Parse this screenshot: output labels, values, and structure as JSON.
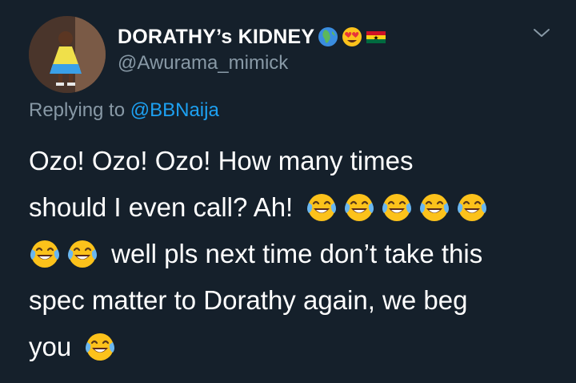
{
  "tweet": {
    "author": {
      "display_name": "DORATHY’s KIDNEY",
      "name_emojis": [
        "globe-africa-icon",
        "heart-eyes-icon",
        "ghana-flag-icon"
      ],
      "handle": "@Awurama_mimick",
      "avatar": "avatar"
    },
    "reply": {
      "prefix": "Replying to ",
      "target": "@BBNaija"
    },
    "text_lines": [
      "Ozo! Ozo! Ozo! How many times",
      "should I even call? Ah! ",
      " well pls next time don’t take this",
      "spec matter to Dorathy again, we beg",
      "you "
    ],
    "text_emoji": "face-with-tears-of-joy-icon",
    "more_icon": "chevron-down-icon"
  },
  "colors": {
    "background": "#15202b",
    "text": "#ffffff",
    "secondary": "#8899a6",
    "link": "#1da1f2"
  }
}
